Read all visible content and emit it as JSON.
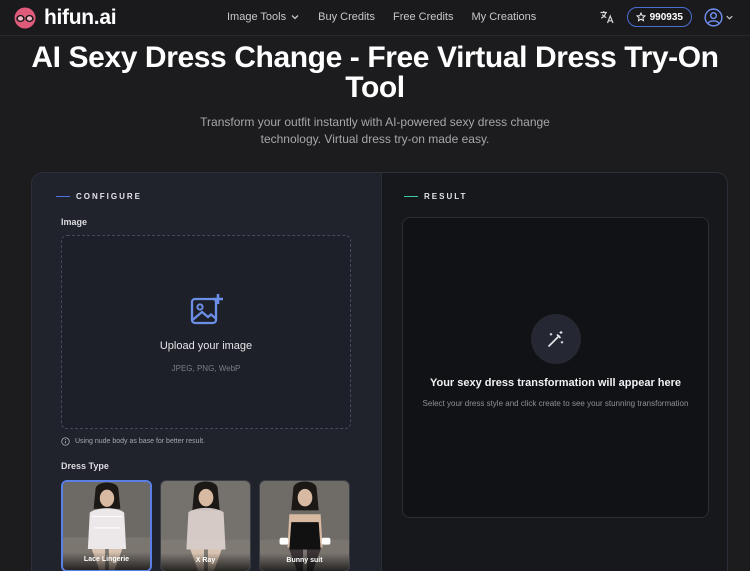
{
  "brand": {
    "name": "hifun.ai"
  },
  "nav": {
    "links": [
      {
        "label": "Image Tools",
        "has_dropdown": true
      },
      {
        "label": "Buy Credits"
      },
      {
        "label": "Free Credits"
      },
      {
        "label": "My Creations"
      }
    ],
    "credits": "990935",
    "icons": {
      "translate": "translate-icon",
      "credits": "star-icon",
      "user": "user-avatar-icon"
    }
  },
  "hero": {
    "title": "AI Sexy Dress Change - Free Virtual Dress Try-On Tool",
    "subtitle": "Transform your outfit instantly with AI-powered sexy dress change technology. Virtual dress try-on made easy."
  },
  "configure": {
    "section_label": "CONFIGURE",
    "image_label": "Image",
    "upload_title": "Upload your image",
    "upload_types": "JPEG, PNG, WebP",
    "hint": "Using nude body as base for better result.",
    "dress_type_label": "Dress Type",
    "dress_types": [
      {
        "label": "Lace Lingerie",
        "selected": true
      },
      {
        "label": "X Ray",
        "selected": false
      },
      {
        "label": "Bunny suit",
        "selected": false
      }
    ]
  },
  "result": {
    "section_label": "RESULT",
    "title": "Your sexy dress transformation will appear here",
    "description": "Select your dress style and click create to see your stunning transformation"
  },
  "colors": {
    "accent_blue": "#5072e0",
    "accent_teal": "#3ec9a8",
    "background": "#1c1c1f"
  }
}
